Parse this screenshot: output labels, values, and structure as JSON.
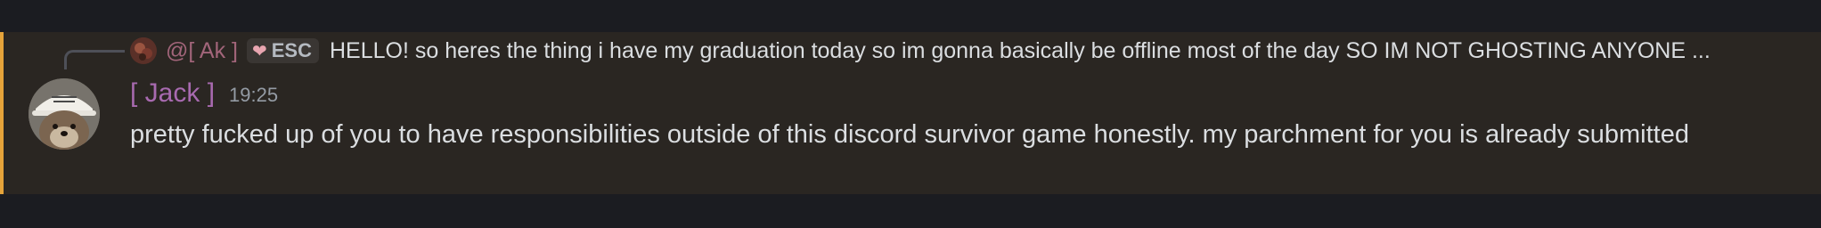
{
  "reply": {
    "author": "@[ Ak ]",
    "role_tag": "ESC",
    "content": "HELLO! so heres the thing i have my graduation today so im gonna basically be offline most of the day SO IM NOT GHOSTING ANYONE ..."
  },
  "message": {
    "author": "[ Jack ]",
    "timestamp": "19:25",
    "content": "pretty fucked up of you to have responsibilities outside of this discord survivor game honestly. my parchment for you is already submitted"
  },
  "colors": {
    "background": "#1b1c21",
    "highlight_background": "#2a2622",
    "mention_bar": "#e5a33a",
    "reply_author": "#a2657a",
    "author": "#a86ab0",
    "text": "#dbdee1",
    "timestamp": "#949ba4"
  },
  "icons": {
    "role_icon": "heart-icon"
  }
}
